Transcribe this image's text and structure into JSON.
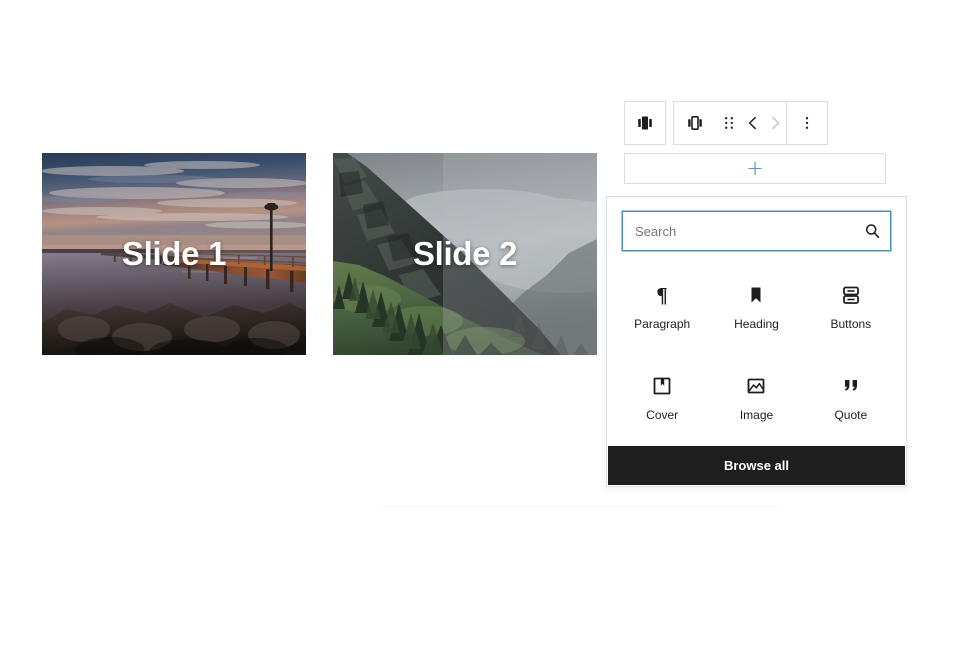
{
  "editor": {
    "slides": [
      {
        "caption": "Slide 1",
        "scene": "pier-sunset-over-water-with-rocks",
        "name": "slide-1"
      },
      {
        "caption": "Slide 2",
        "scene": "foggy-mountain-with-pine-trees",
        "name": "slide-2"
      }
    ]
  },
  "toolbar": {
    "parent_block_icon": "carousel-filled-icon",
    "block_type_icon": "carousel-outline-icon",
    "drag_handle_icon": "drag-handle-icon",
    "move_prev_icon": "chevron-left-icon",
    "move_next_icon": "chevron-right-icon",
    "more_options_icon": "ellipsis-vertical-icon",
    "move_next_disabled": true
  },
  "appender": {
    "plus_icon": "plus-icon",
    "plus_glyph": "+",
    "accent_color": "#4a8bb5"
  },
  "inserter": {
    "search": {
      "value": "",
      "placeholder": "Search",
      "icon": "search-icon",
      "focus_border_color": "#4f8fad"
    },
    "blocks": [
      {
        "label": "Paragraph",
        "icon": "paragraph-icon"
      },
      {
        "label": "Heading",
        "icon": "heading-icon"
      },
      {
        "label": "Buttons",
        "icon": "buttons-icon"
      },
      {
        "label": "Cover",
        "icon": "cover-icon"
      },
      {
        "label": "Image",
        "icon": "image-icon"
      },
      {
        "label": "Quote",
        "icon": "quote-icon"
      }
    ],
    "browse_all_label": "Browse all",
    "browse_all_bg": "#1e1e1e"
  }
}
